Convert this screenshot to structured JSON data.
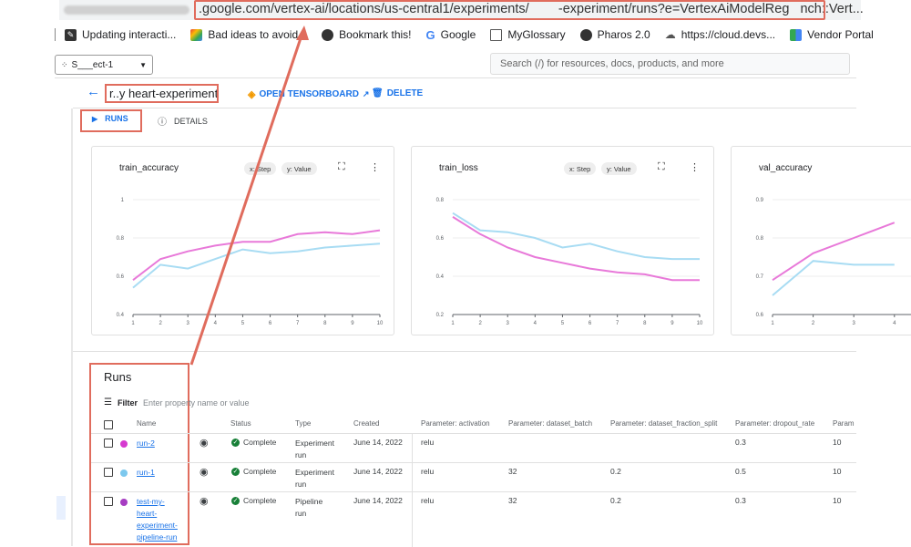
{
  "browser": {
    "url_visible": ".google.com/vertex-ai/locations/us-central1/experiments/",
    "url_mid": "-experiment/runs?e=VertexAiModelReg",
    "url_end": "nch::Vert..."
  },
  "bookmarks": [
    {
      "label": "Updating interacti...",
      "icon": "edit-icon",
      "color": "#333333"
    },
    {
      "label": "Bad ideas to avoid...",
      "icon": "puzzle-icon",
      "color": "#4285f4"
    },
    {
      "label": "Bookmark this!",
      "icon": "globe-icon",
      "color": "#333333"
    },
    {
      "label": "Google",
      "icon": "google-icon",
      "color": "#4285f4"
    },
    {
      "label": "MyGlossary",
      "icon": "folder-icon",
      "color": "#555555"
    },
    {
      "label": "Pharos 2.0",
      "icon": "globe-icon",
      "color": "#333333"
    },
    {
      "label": "https://cloud.devs...",
      "icon": "cloud-icon",
      "color": "#555555"
    },
    {
      "label": "Vendor Portal",
      "icon": "google-icon",
      "color": "#34a853"
    }
  ],
  "header": {
    "project": "S___ect-1",
    "search_placeholder": "Search (/) for resources, docs, products, and more"
  },
  "page": {
    "experiment_title": "r..y heart-experiment",
    "open_tensorboard": "OPEN TENSORBOARD",
    "delete": "DELETE",
    "tabs": [
      {
        "label": "RUNS",
        "active": true
      },
      {
        "label": "DETAILS",
        "active": false
      }
    ]
  },
  "cards": [
    {
      "title": "train_accuracy",
      "chip_x": "x: Step",
      "chip_y": "y: Value"
    },
    {
      "title": "train_loss",
      "chip_x": "x: Step",
      "chip_y": "y: Value"
    },
    {
      "title": "val_accuracy",
      "chip_x": "",
      "chip_y": ""
    }
  ],
  "chart_data": [
    {
      "type": "line",
      "title": "train_accuracy",
      "x": [
        1,
        2,
        3,
        4,
        5,
        6,
        7,
        8,
        9,
        10
      ],
      "ylim": [
        0.4,
        1.0
      ],
      "yticks": [
        "1",
        "0.8",
        "0.6",
        "0.4"
      ],
      "series": [
        {
          "color": "#e879d9",
          "values": [
            0.58,
            0.69,
            0.73,
            0.76,
            0.78,
            0.78,
            0.82,
            0.83,
            0.82,
            0.84
          ]
        },
        {
          "color": "#a8dcf3",
          "values": [
            0.54,
            0.66,
            0.64,
            0.69,
            0.74,
            0.72,
            0.73,
            0.75,
            0.76,
            0.77
          ]
        }
      ]
    },
    {
      "type": "line",
      "title": "train_loss",
      "x": [
        1,
        2,
        3,
        4,
        5,
        6,
        7,
        8,
        9,
        10
      ],
      "ylim": [
        0.2,
        0.8
      ],
      "yticks": [
        "0.8",
        "0.6",
        "0.4",
        "0.2"
      ],
      "series": [
        {
          "color": "#e879d9",
          "values": [
            0.71,
            0.62,
            0.55,
            0.5,
            0.47,
            0.44,
            0.42,
            0.41,
            0.38,
            0.38
          ]
        },
        {
          "color": "#a8dcf3",
          "values": [
            0.73,
            0.64,
            0.63,
            0.6,
            0.55,
            0.57,
            0.53,
            0.5,
            0.49,
            0.49
          ]
        }
      ]
    },
    {
      "type": "line",
      "title": "val_accuracy",
      "x": [
        1,
        2,
        3,
        4
      ],
      "ylim": [
        0.6,
        0.9
      ],
      "yticks": [
        "0.9",
        "0.8",
        "0.7",
        "0.6"
      ],
      "series": [
        {
          "color": "#e879d9",
          "values": [
            0.69,
            0.76,
            0.8,
            0.84
          ]
        },
        {
          "color": "#a8dcf3",
          "values": [
            0.65,
            0.74,
            0.73,
            0.73
          ]
        }
      ]
    }
  ],
  "runs": {
    "heading": "Runs",
    "filter_label": "Filter",
    "filter_placeholder": "Enter property name or value",
    "columns": [
      "Name",
      "Status",
      "Type",
      "Created",
      "Parameter: activation",
      "Parameter: dataset_batch",
      "Parameter: dataset_fraction_split",
      "Parameter: dropout_rate",
      "Param"
    ],
    "rows": [
      {
        "dot": "#d63ad0",
        "name": [
          "run-2"
        ],
        "status": "Complete",
        "type": [
          "Experiment",
          "run"
        ],
        "created": "June 14, 2022",
        "activation": "relu",
        "batch": "",
        "split": "",
        "dropout": "0.3",
        "param": "10"
      },
      {
        "dot": "#7cc8ee",
        "name": [
          "run-1"
        ],
        "status": "Complete",
        "type": [
          "Experiment",
          "run"
        ],
        "created": "June 14, 2022",
        "activation": "relu",
        "batch": "32",
        "split": "0.2",
        "dropout": "0.5",
        "param": "10"
      },
      {
        "dot": "#a63dc2",
        "name": [
          "test-my-",
          "heart-",
          "experiment-",
          "pipeline-run"
        ],
        "status": "Complete",
        "type": [
          "Pipeline",
          "run"
        ],
        "created": "June 14, 2022",
        "activation": "relu",
        "batch": "32",
        "split": "0.2",
        "dropout": "0.3",
        "param": "10"
      }
    ]
  }
}
